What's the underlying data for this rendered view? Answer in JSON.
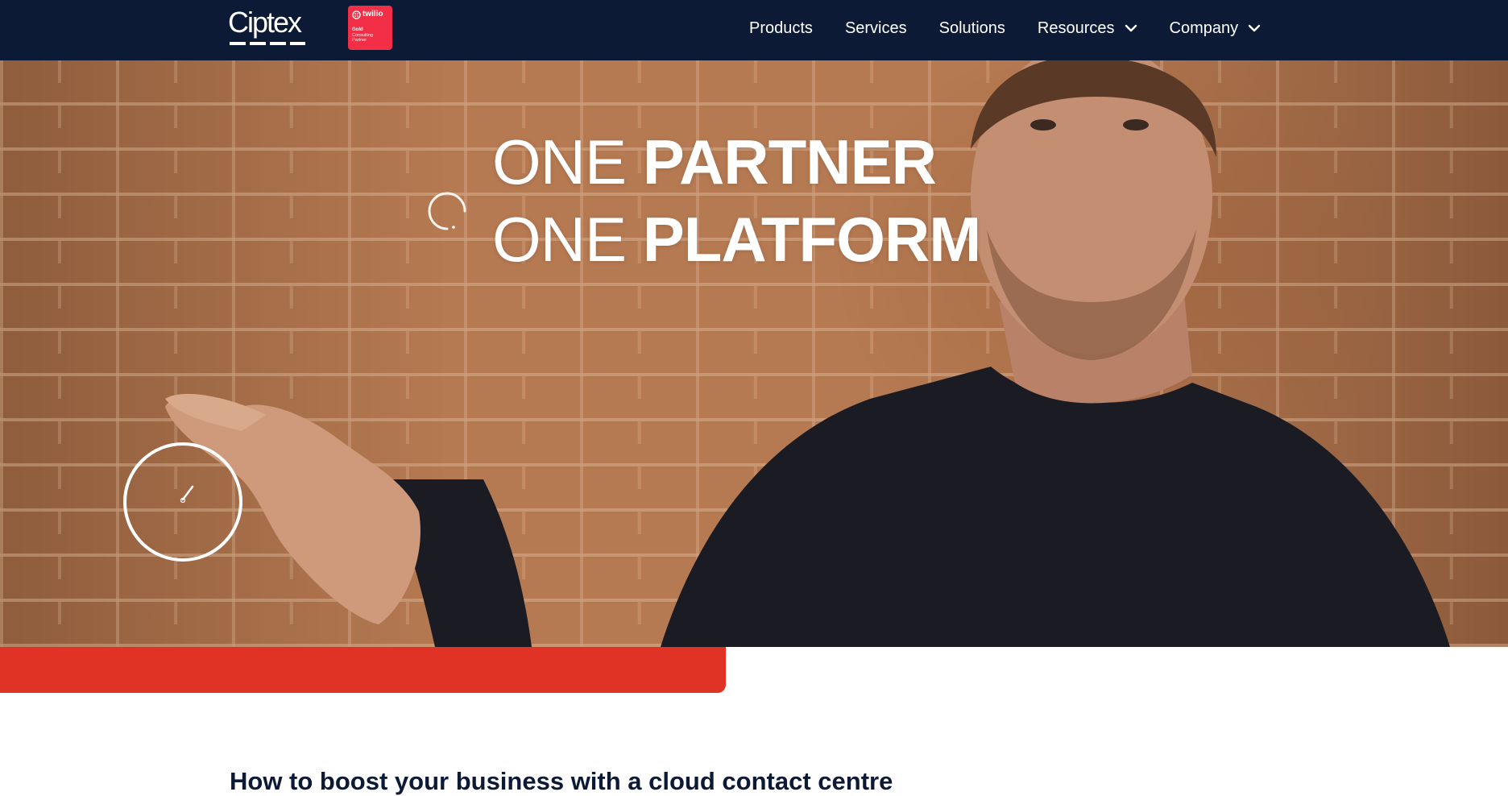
{
  "nav": {
    "logo_text": "Ciptex",
    "badge": {
      "brand": "twilio",
      "tier": "Gold",
      "line1": "Consulting",
      "line2": "Partner"
    },
    "items": [
      {
        "label": "Products",
        "has_dropdown": false
      },
      {
        "label": "Services",
        "has_dropdown": false
      },
      {
        "label": "Solutions",
        "has_dropdown": false
      },
      {
        "label": "Resources",
        "has_dropdown": true
      },
      {
        "label": "Company",
        "has_dropdown": true
      }
    ],
    "chevron_icon": "chevron-down-icon"
  },
  "hero": {
    "line1": {
      "light": "ONE ",
      "bold": "PARTNER"
    },
    "line2": {
      "light": "ONE ",
      "bold": "PLATFORM"
    },
    "play_icon": "play-circle-icon",
    "spinner_icon": "loading-spinner-icon"
  },
  "section": {
    "heading": "How to boost your business with a cloud contact centre"
  },
  "colors": {
    "nav_bg": "#0d1a36",
    "accent_red": "#e13325",
    "badge_red": "#f22f46",
    "text_dark": "#0d1a36"
  }
}
